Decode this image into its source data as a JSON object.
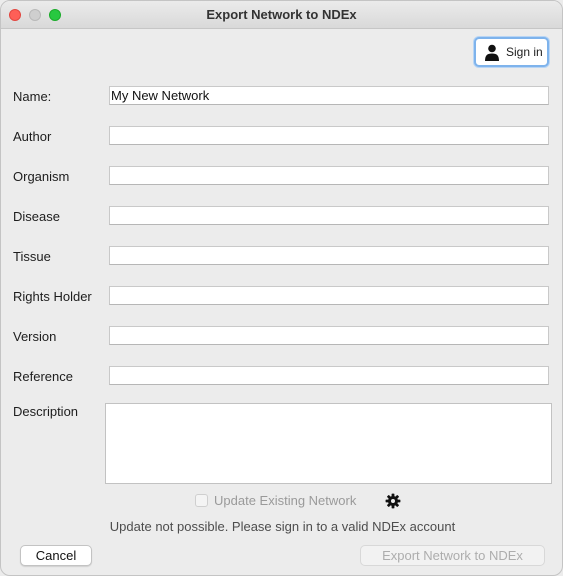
{
  "window": {
    "title": "Export Network to NDEx"
  },
  "signin": {
    "label": "Sign in",
    "icon": "user-icon"
  },
  "fields": [
    {
      "label": "Name:",
      "value": "My New Network"
    },
    {
      "label": "Author",
      "value": ""
    },
    {
      "label": "Organism",
      "value": ""
    },
    {
      "label": "Disease",
      "value": ""
    },
    {
      "label": "Tissue",
      "value": ""
    },
    {
      "label": "Rights Holder",
      "value": ""
    },
    {
      "label": "Version",
      "value": ""
    },
    {
      "label": "Reference",
      "value": ""
    }
  ],
  "description": {
    "label": "Description",
    "value": ""
  },
  "update": {
    "label": "Update Existing Network",
    "checked": false,
    "enabled": false
  },
  "note": "Update not possible. Please sign in to a valid NDEx account",
  "buttons": {
    "cancel": "Cancel",
    "export": "Export Network to NDEx"
  }
}
